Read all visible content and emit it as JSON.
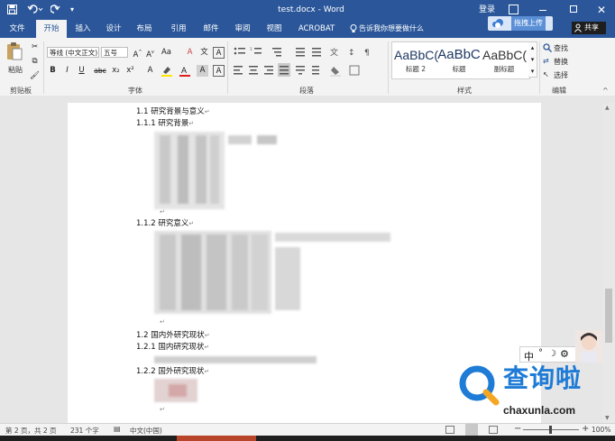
{
  "window": {
    "title": "test.docx - Word",
    "login_label": "登录",
    "share_cloud_label": "拖拽上传",
    "share_label": "共享",
    "quick_access": [
      "save-icon",
      "undo-icon",
      "redo-icon",
      "customize-icon"
    ],
    "controls": [
      "ribbon-display-icon",
      "minimize-icon",
      "restore-icon",
      "close-icon"
    ]
  },
  "tabs": [
    {
      "label": "文件",
      "active": false
    },
    {
      "label": "开始",
      "active": true
    },
    {
      "label": "插入",
      "active": false
    },
    {
      "label": "设计",
      "active": false
    },
    {
      "label": "布局",
      "active": false
    },
    {
      "label": "引用",
      "active": false
    },
    {
      "label": "邮件",
      "active": false
    },
    {
      "label": "审阅",
      "active": false
    },
    {
      "label": "视图",
      "active": false
    },
    {
      "label": "ACROBAT",
      "active": false
    }
  ],
  "tell_me": "告诉我你想要做什么",
  "ribbon": {
    "clipboard": {
      "label": "剪贴板",
      "paste_label": "粘贴"
    },
    "font": {
      "label": "字体",
      "font_name": "等线 (中文正文)",
      "font_size": "五号",
      "row2": [
        "B",
        "I",
        "U",
        "abc",
        "x₂",
        "x²"
      ]
    },
    "paragraph": {
      "label": "段落"
    },
    "styles": {
      "label": "样式",
      "items": [
        {
          "preview": "AaBbC(",
          "name": "标题 2"
        },
        {
          "preview": "AaBbC",
          "name": "标题"
        },
        {
          "preview": "AaBbC(",
          "name": "副标题"
        }
      ]
    },
    "editing": {
      "label": "编辑",
      "find_label": "查找",
      "replace_label": "替换",
      "select_label": "选择"
    }
  },
  "document": {
    "headings": [
      "1.1 研究背景与意义",
      "1.1.1 研究背景",
      "1.1.2 研究意义",
      "1.2 国内外研究现状",
      "1.2.1 国内研究现状",
      "1.2.2 国外研究现状"
    ],
    "return_mark": "↵"
  },
  "ime_toolbar": {
    "mode_label": "中",
    "punct_label": "°",
    "moon_icon": "moon-icon",
    "gear_icon": "gear-icon"
  },
  "watermark": {
    "cn_text": "查询啦",
    "url_text": "chaxunla.com"
  },
  "status": {
    "page": "第 2 页，共 2 页",
    "words": "231 个字",
    "language": "中文(中国)",
    "zoom": "100%",
    "zoom_minus": "−",
    "zoom_plus": "+"
  },
  "colors": {
    "title_blue": "#2b579a",
    "ribbon_bg": "#f3f3f3",
    "workspace": "#e6e6e6",
    "watermark_blue": "#1e7bd6"
  }
}
